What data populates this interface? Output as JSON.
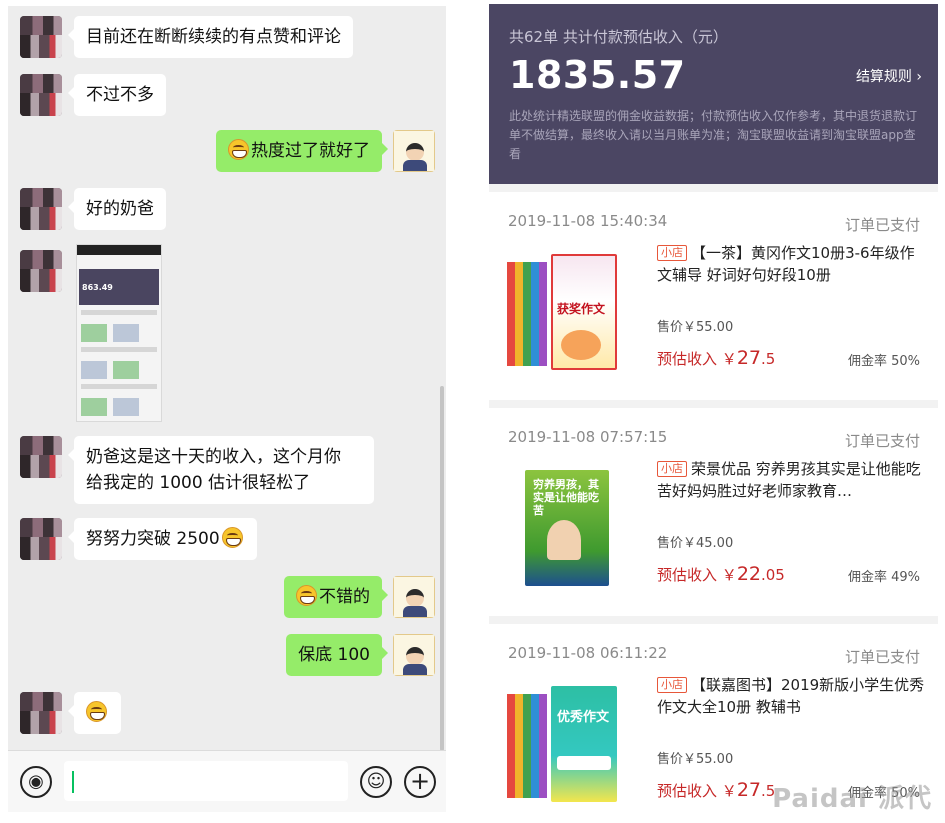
{
  "chat": {
    "messages": [
      {
        "side": "in",
        "text": "目前还在断断续续的有点赞和评论"
      },
      {
        "side": "in",
        "text": "不过不多"
      },
      {
        "side": "out",
        "text": "热度过了就好了",
        "emoji": "grin-emoji"
      },
      {
        "side": "in",
        "text": "好的奶爸"
      },
      {
        "side": "in",
        "type": "image",
        "image_amount": "863.49"
      },
      {
        "side": "in",
        "text_line1": "奶爸这是这十天的收入，这个月你",
        "text_line2": "给我定的 1000 估计很轻松了"
      },
      {
        "side": "in",
        "text": "努努力突破 2500",
        "emoji": "grin-emoji"
      },
      {
        "side": "out",
        "text": "不错的",
        "emoji": "grin-emoji"
      },
      {
        "side": "out",
        "text": "保底 100"
      },
      {
        "side": "in",
        "text": "",
        "emoji": "grin-emoji"
      }
    ],
    "input": {
      "value": "",
      "placeholder": ""
    },
    "icons": {
      "voice": "voice-icon",
      "emoji": "emoji-icon",
      "plus": "plus-icon"
    },
    "colors": {
      "out_bubble": "#95ec69",
      "in_bubble": "#ffffff",
      "background": "#ededed"
    }
  },
  "summary": {
    "caption": "共62单 共计付款预估收入（元）",
    "amount": "1835.57",
    "rules_link": "结算规则",
    "note": "此处统计精选联盟的佣金收益数据；付款预估收入仅作参考，其中退货退款订单不做结算，最终收入请以当月账单为准；淘宝联盟收益请到淘宝联盟app查看",
    "colors": {
      "background": "#4b4663"
    }
  },
  "orders": [
    {
      "time": "2019-11-08 15:40:34",
      "status": "订单已支付",
      "shop_tag": "小店",
      "title": "【一茶】黄冈作文10册3-6年级作文辅导 好词好句好段10册",
      "price": "售价￥55.00",
      "income_label": "预估收入",
      "income_currency": "￥",
      "income_int": "27",
      "income_dec": ".5",
      "rate": "佣金率 50%",
      "cover_text": "获奖作文"
    },
    {
      "time": "2019-11-08 07:57:15",
      "status": "订单已支付",
      "shop_tag": "小店",
      "title": "荣景优品 穷养男孩其实是让他能吃苦好妈妈胜过好老师家教育…",
      "price": "售价￥45.00",
      "income_label": "预估收入",
      "income_currency": "￥",
      "income_int": "22",
      "income_dec": ".05",
      "rate": "佣金率 49%",
      "cover_text": "穷养男孩，其实是让他能吃苦"
    },
    {
      "time": "2019-11-08 06:11:22",
      "status": "订单已支付",
      "shop_tag": "小店",
      "title": "【联嘉图书】2019新版小学生优秀作文大全10册 教辅书",
      "price": "售价￥55.00",
      "income_label": "预估收入",
      "income_currency": "￥",
      "income_int": "27",
      "income_dec": ".5",
      "rate": "佣金率 50%",
      "cover_text": "优秀作文"
    }
  ],
  "watermark": "Paidai 派代"
}
